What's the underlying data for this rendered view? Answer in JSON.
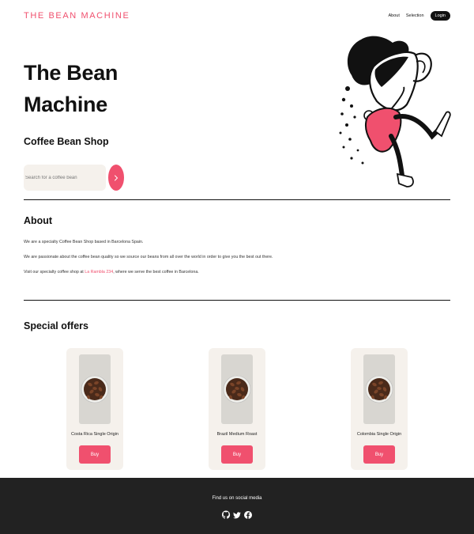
{
  "nav": {
    "logo": "THE BEAN MACHINE",
    "about": "About",
    "selection": "Selection",
    "login": "Login"
  },
  "hero": {
    "title_line1": "The Bean",
    "title_line2": "Machine",
    "subtitle": "Coffee Bean Shop",
    "search_placeholder": "Search for a coffee bean",
    "search_icon": "chevron-right-icon"
  },
  "about": {
    "title": "About",
    "p1": "We are a specialty Coffee Bean Shop based in Barcelona Spain.",
    "p2": "We are passionate about the coffee bean quality so we source our beans from all over the world in order to give you the best out there.",
    "p3_before": "Visit our specialty coffee shop at ",
    "p3_link": "La Rambla 234",
    "p3_after": ", where we serve the best coffee in Barcelona."
  },
  "offers": {
    "title": "Special offers",
    "items": [
      {
        "name": "Costa Rica Single Origin",
        "buy": "Buy"
      },
      {
        "name": "Brazil Medium Roast",
        "buy": "Buy"
      },
      {
        "name": "Colombia Single Origin",
        "buy": "Buy"
      }
    ]
  },
  "footer": {
    "text": "Find us on social media",
    "icons": [
      "github-icon",
      "twitter-icon",
      "facebook-icon"
    ]
  },
  "colors": {
    "accent": "#f0506e",
    "card_bg": "#f5f1ec",
    "footer_bg": "#222222"
  }
}
